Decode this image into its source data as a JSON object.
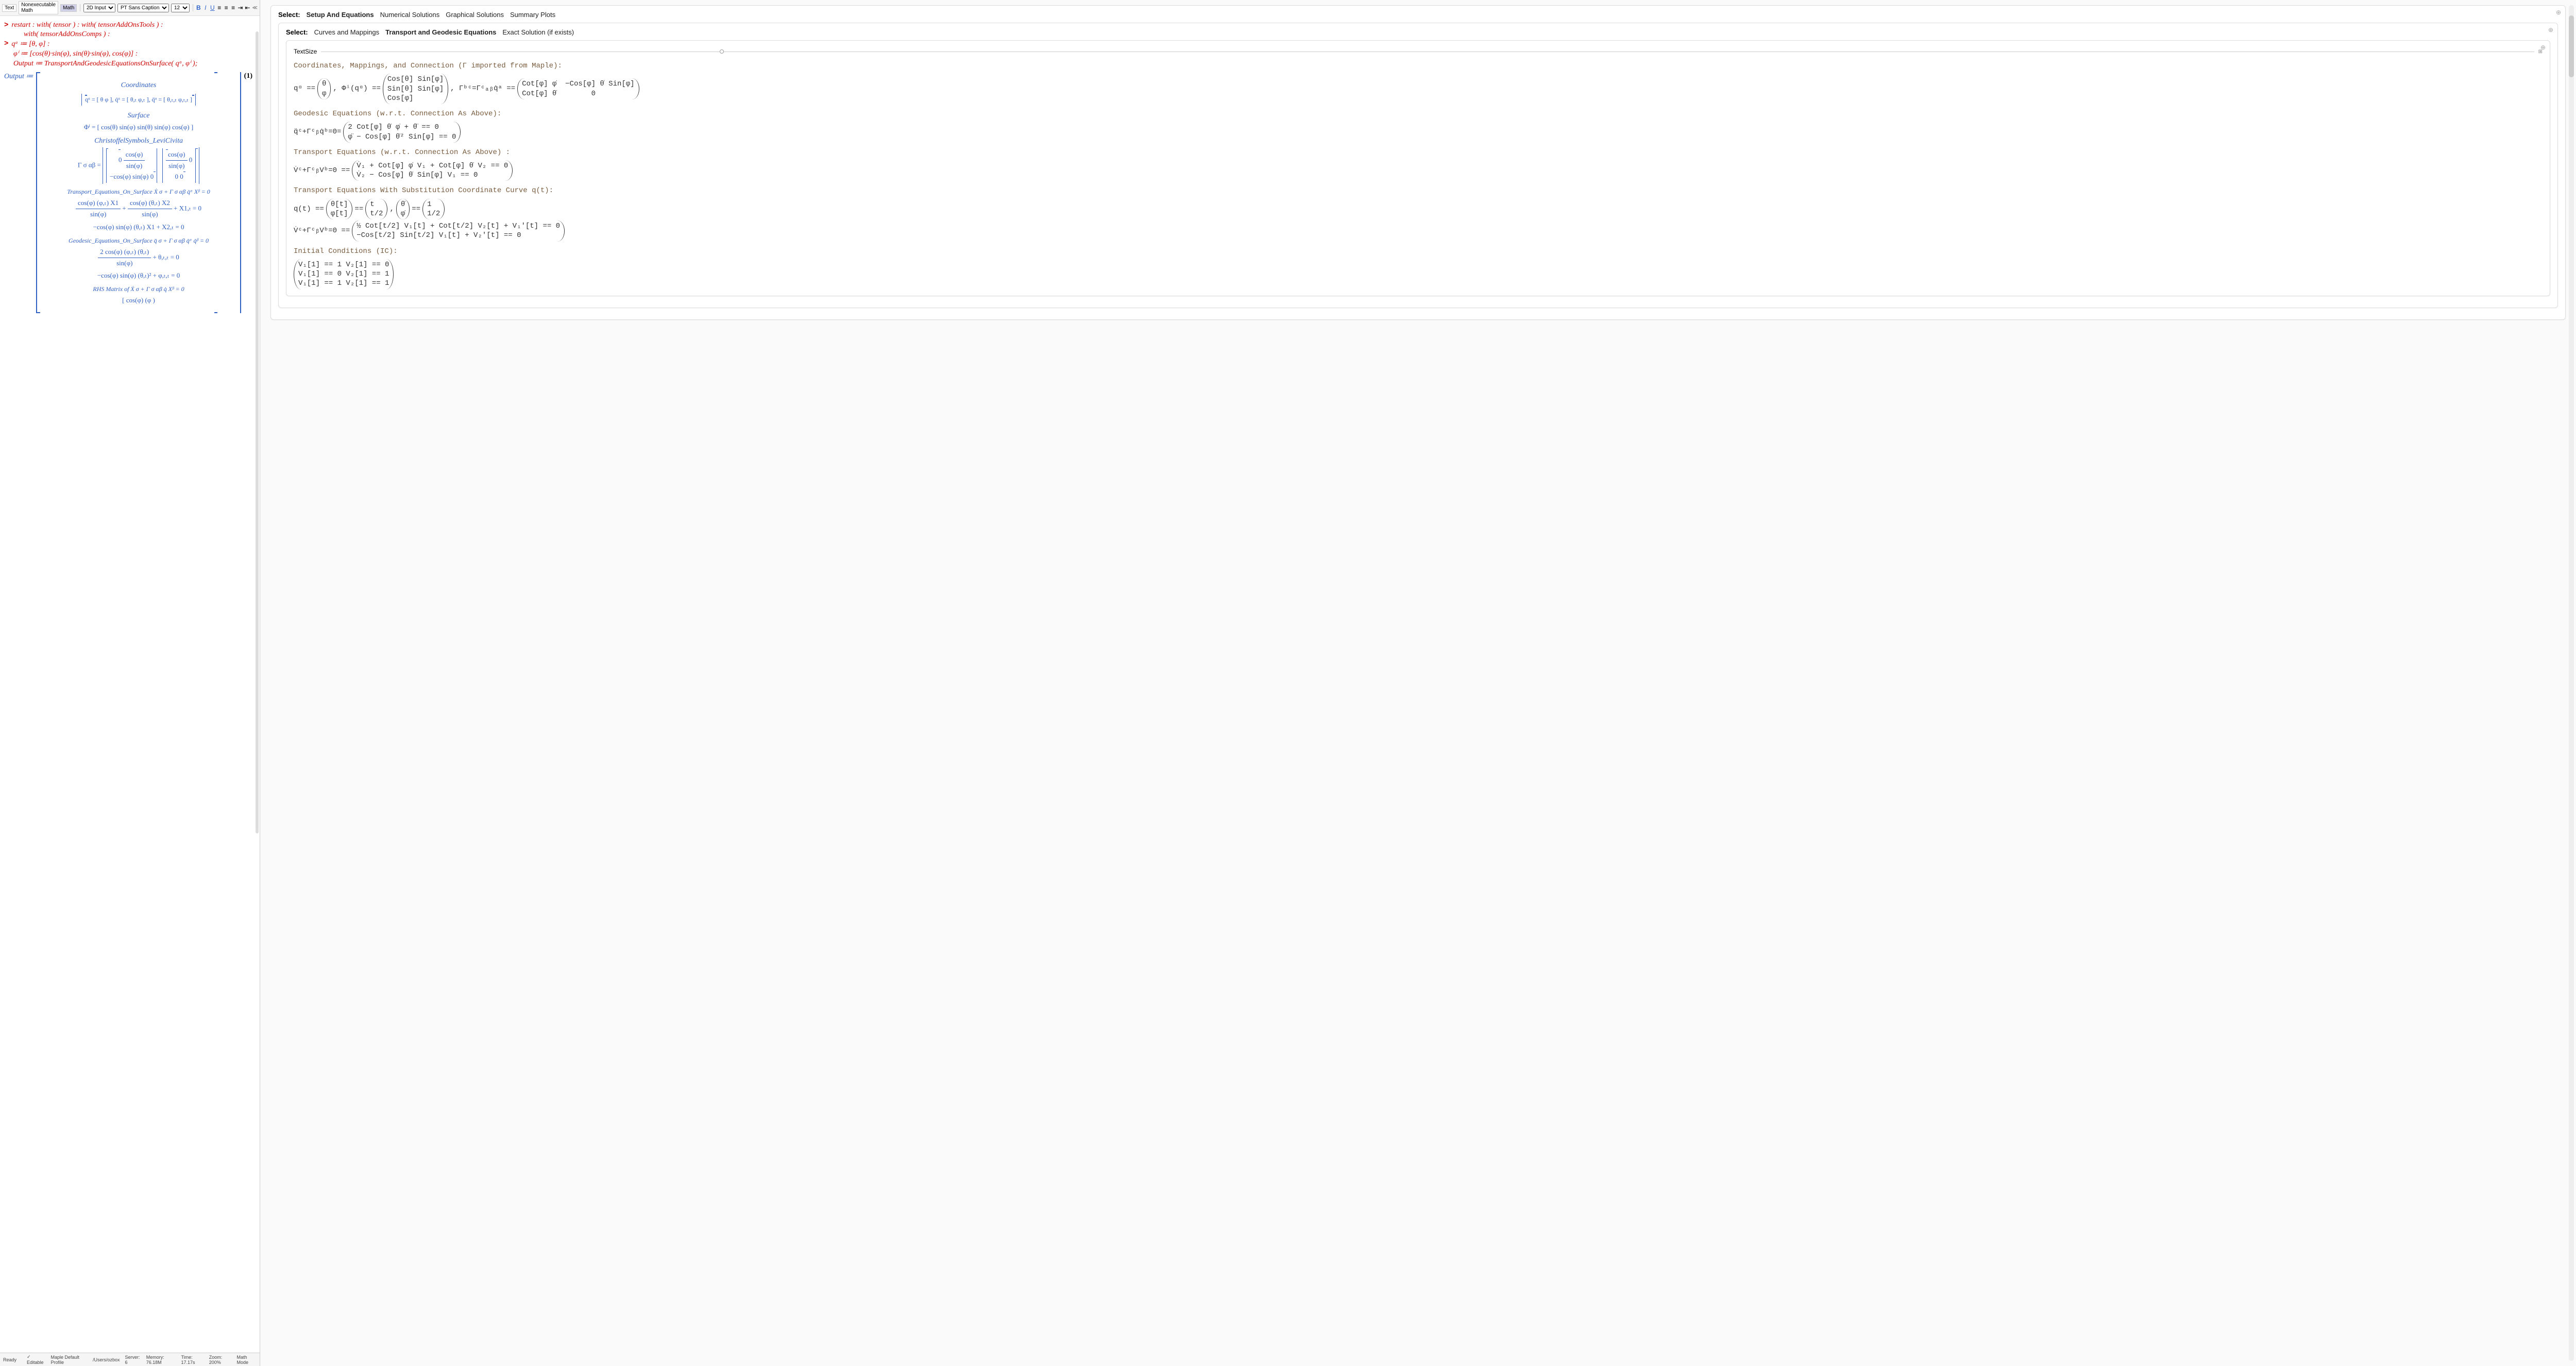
{
  "toolbar": {
    "mode_text": "Text",
    "mode_nonexec": "Nonexecutable Math",
    "mode_math": "Math",
    "input_style": "2D Input",
    "font": "PT Sans Caption",
    "size": "12",
    "bold": "B",
    "italic": "I",
    "underline": "U",
    "collapse": "≪"
  },
  "worksheet": {
    "line1": "restart : with( tensor ) : with( tensorAddOnsTools ) :",
    "line1b": "with( tensorAddOnsComps ) :",
    "line2": "qᵃ ≔ [θ, φ] :",
    "line3": "φⁱ ≔ [cos(θ)·sin(φ), sin(θ)·sin(φ), cos(φ)] :",
    "line4": "Output ≔ TransportAndGeodesicEquationsOnSurface( qᵃ, φⁱ );",
    "output_label": "Output ≔",
    "eq_tag": "(1)",
    "sec_coordinates": "Coordinates",
    "coords_eq": "qᵅ = [ θ  φ ], q̇ᵅ = [ θ,ₜ  φ,ₜ ], q̈ᵅ = [ θ,ₜ,ₜ  φ,ₜ,ₜ ]",
    "sec_surface": "Surface",
    "surface_eq": "Φⁱ = [ cos(θ) sin(φ)   sin(θ) sin(φ)   cos(φ) ]",
    "sec_christoffel": "ChristoffelSymbols_LeviCivita",
    "gamma_lhs": "Γ σ αβ =",
    "gamma_m00_num": "cos(φ)",
    "gamma_m00_den": "sin(φ)",
    "gamma_m01": "0",
    "gamma_m10": "−cos(φ) sin(φ)   0",
    "gamma_m11": "0   0",
    "sec_transport": "Transport_Equations_On_Surface Ẋ σ + Γ σ αβ q̇ᵅ Xᵝ = 0",
    "transport_eq1_num1": "cos(φ) (φ,ₜ) X1",
    "transport_eq1_den1": "sin(φ)",
    "transport_eq1_plus": "+",
    "transport_eq1_num2": "cos(φ) (θ,ₜ) X2",
    "transport_eq1_den2": "sin(φ)",
    "transport_eq1_tail": "+ X1,ₜ = 0",
    "transport_eq2": "−cos(φ) sin(φ) (θ,ₜ) X1 + X2,ₜ = 0",
    "sec_geodesic": "Geodesic_Equations_On_Surface q̈ σ + Γ σ αβ q̇ᵅ q̇ᵝ = 0",
    "geodesic_eq1_num": "2 cos(φ) (φ,ₜ) (θ,ₜ)",
    "geodesic_eq1_den": "sin(φ)",
    "geodesic_eq1_tail": "+ θ,ₜ,ₜ = 0",
    "geodesic_eq2": "−cos(φ) sin(φ) (θ,ₜ)² + φ,ₜ,ₜ = 0",
    "sec_rhs": "RHS Matrix of Ẋ σ + Γ σ αβ q̇ Xᵝ = 0",
    "rhs_peek": "[ cos(φ) (φ )"
  },
  "statusbar": {
    "ready": "Ready",
    "editable": "✓ Editable",
    "profile": "Maple Default Profile",
    "path": "/Users/ozbox",
    "server": "Server: 6",
    "memory": "Memory: 76.18M",
    "time": "Time: 17.17s",
    "zoom": "Zoom: 200%",
    "mode": "Math Mode"
  },
  "right": {
    "select1_label": "Select:",
    "tabs1": [
      "Setup And Equations",
      "Numerical Solutions",
      "Graphical Solutions",
      "Summary Plots"
    ],
    "select2_label": "Select:",
    "tabs2": [
      "Curves and Mappings",
      "Transport and Geodesic Equations",
      "Exact Solution (if exists)"
    ],
    "textsize": "TextSize",
    "hdr1": "Coordinates, Mappings, and Connection (Γ imported from Maple):",
    "coords_q": "qᵅ ==",
    "coords_q_r1": "θ",
    "coords_q_r2": "φ",
    "coords_phi": ", Φⁱ(qᵅ) ==",
    "coords_phi_r1": "Cos[θ] Sin[φ]",
    "coords_phi_r2": "Sin[θ] Sin[φ]",
    "coords_phi_r3": "Cos[φ]",
    "coords_gamma": ", Γᵇᶜ=Γᶜₐᵦq̇ᵃ ==",
    "coords_g_r11": "Cot[φ] φ̇",
    "coords_g_r12": "−Cos[φ] θ̇ Sin[φ]",
    "coords_g_r21": "Cot[φ] θ̇",
    "coords_g_r22": "0",
    "hdr2": "Geodesic Equations (w.r.t. Connection As Above):",
    "geo_lhs": "q̈ᶜ+Γᶜᵦq̇ᵇ=0=",
    "geo_r1": "2 Cot[φ] θ̇ φ̇ + θ̈ == 0",
    "geo_r2": "φ̈ − Cos[φ] θ̇² Sin[φ] == 0",
    "hdr3": "Transport Equations (w.r.t. Connection As Above) :",
    "tr_lhs": "V̇ᶜ+ΓᶜᵦVᵇ=0 ==",
    "tr_r1": "V̇₁ + Cot[φ] φ̇ V₁ + Cot[φ] θ̇ V₂ == 0",
    "tr_r2": "V̇₂ − Cos[φ] θ̇ Sin[φ] V₁ == 0",
    "hdr4": "Transport Equations With Substitution Coordinate Curve q(t):",
    "sub_q": "q(t) ==",
    "sub_q_r1": "θ[t]",
    "sub_q_r2": "φ[t]",
    "sub_eq": "==",
    "sub_v_r1": "t",
    "sub_v_r2": "t/2",
    "sub_comma": ",",
    "sub_d": "==",
    "sub_d_lhs_r1": "θ̇",
    "sub_d_lhs_r2": "φ̇",
    "sub_d_r1": "1",
    "sub_d_r2": "1/2",
    "sub2_lhs": "V̇ᶜ+ΓᶜᵦVᵇ=0 ==",
    "sub2_r1": "½ Cot[t/2] V₁[t] + Cot[t/2] V₂[t] + V₁′[t] == 0",
    "sub2_r2": "−Cos[t/2] Sin[t/2] V₁[t] + V₂′[t] == 0",
    "hdr5": "Initial Conditions (IC):",
    "ic_r1": "V₁[1] == 1  V₂[1] == 0",
    "ic_r2": "V₁[1] == 0  V₂[1] == 1",
    "ic_r3": "V₁[1] == 1  V₂[1] == 1"
  },
  "chart_data": {
    "type": "table",
    "title": "Transport & Geodesic equations on 2-sphere surface",
    "coordinates": [
      "θ",
      "φ"
    ],
    "embedding": [
      "cos(θ) sin(φ)",
      "sin(θ) sin(φ)",
      "cos(φ)"
    ],
    "christoffel_nonzero": {
      "Γ^θ_θφ": "cos(φ)/sin(φ)",
      "Γ^θ_φθ": "cos(φ)/sin(φ)",
      "Γ^φ_θθ": "−cos(φ) sin(φ)"
    },
    "geodesic_equations": [
      "2 cot(φ) θ̇ φ̇ + θ̈ = 0",
      "φ̈ − cos(φ) sin(φ) θ̇² = 0"
    ],
    "transport_equations": [
      "V̇₁ + cot(φ) φ̇ V₁ + cot(φ) θ̇ V₂ = 0",
      "V̇₂ − cos(φ) sin(φ) θ̇ V₁ = 0"
    ],
    "curve_substitution": {
      "θ(t)": "t",
      "φ(t)": "t/2",
      "θ̇": 1,
      "φ̇": 0.5
    },
    "initial_conditions": [
      {
        "V1(1)": 1,
        "V2(1)": 0
      },
      {
        "V1(1)": 0,
        "V2(1)": 1
      },
      {
        "V1(1)": 1,
        "V2(1)": 1
      }
    ]
  }
}
